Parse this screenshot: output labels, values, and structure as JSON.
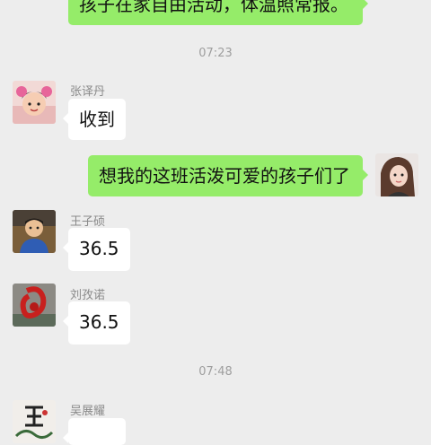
{
  "messages": {
    "first_partial": {
      "text": "孩子在家自由活动，体温照常报。"
    },
    "timestamp_1": "07:23",
    "msg_zhang": {
      "sender": "张译丹",
      "text": "收到"
    },
    "msg_self": {
      "text": "想我的这班活泼可爱的孩子们了"
    },
    "msg_wang": {
      "sender": "王子硕",
      "text": "36.5"
    },
    "msg_liu": {
      "sender": "刘孜诺",
      "text": "36.5"
    },
    "timestamp_2": "07:48",
    "msg_wu": {
      "sender": "吴展耀"
    }
  },
  "colors": {
    "background": "#ededed",
    "bubble_self": "#95ec69",
    "bubble_other": "#ffffff",
    "timestamp": "#9e9e9e",
    "sender_name": "#8a8a8a"
  },
  "avatars": {
    "zhang": "child-with-pink-flower-avatar",
    "self": "woman-portrait-avatar",
    "wang": "boy-in-blue-avatar",
    "liu": "red-ribbon-sculpture-avatar",
    "wu": "calligraphy-wang-avatar"
  }
}
